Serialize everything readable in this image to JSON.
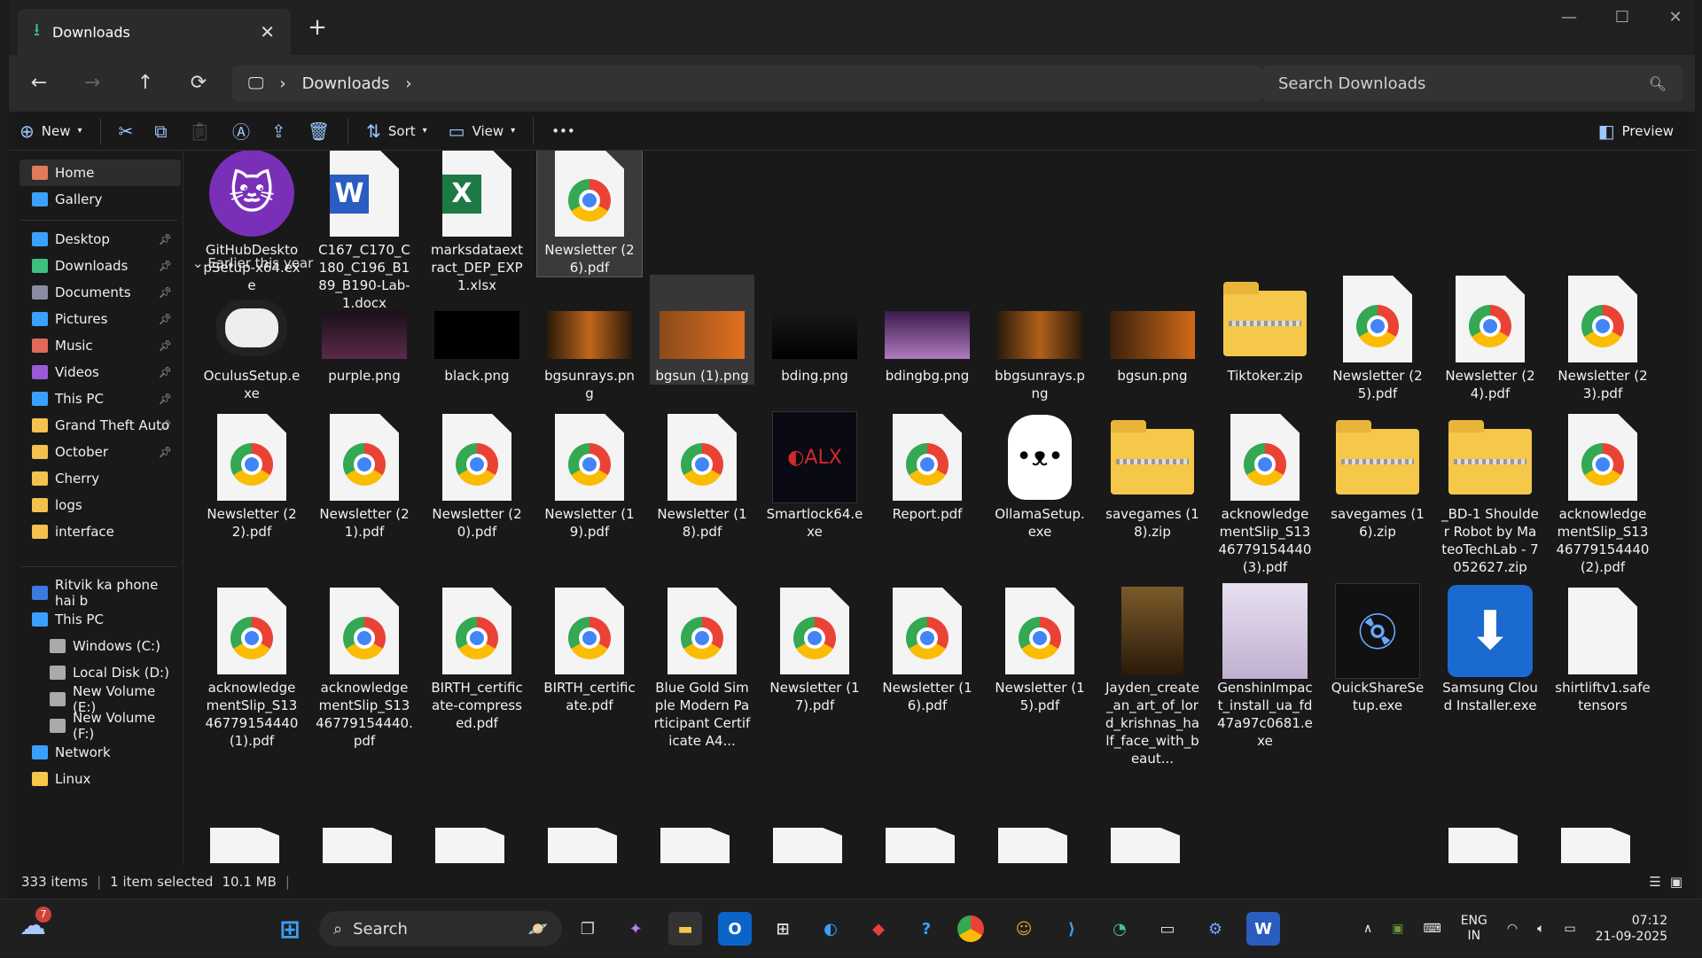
{
  "window": {
    "tab_title": "Downloads",
    "close": "✕",
    "new_tab": "+",
    "minimize": "—",
    "maximize": "☐",
    "close_window": "✕"
  },
  "nav": {
    "back": "←",
    "forward": "→",
    "up": "↑",
    "refresh": "⟳",
    "location": "Downloads",
    "crumb_sep": "›",
    "search_placeholder": "Search Downloads"
  },
  "commands": {
    "new": "New",
    "sort": "Sort",
    "view": "View",
    "more": "•••",
    "preview": "Preview"
  },
  "sidebar": {
    "top": [
      {
        "label": "Home"
      },
      {
        "label": "Gallery"
      }
    ],
    "pinned": [
      {
        "label": "Desktop",
        "color": "#3aa0ff"
      },
      {
        "label": "Downloads",
        "color": "#3fbf7f"
      },
      {
        "label": "Documents",
        "color": "#8a8aa0"
      },
      {
        "label": "Pictures",
        "color": "#3aa0ff"
      },
      {
        "label": "Music",
        "color": "#e06a5a"
      },
      {
        "label": "Videos",
        "color": "#9a5ad8"
      },
      {
        "label": "This PC",
        "color": "#3aa0ff"
      },
      {
        "label": "Grand Theft Auto",
        "color": "#f2c14e"
      },
      {
        "label": "October",
        "color": "#f2c14e"
      },
      {
        "label": "Cherry",
        "color": "#f2c14e"
      },
      {
        "label": "logs",
        "color": "#f2c14e"
      },
      {
        "label": "interface",
        "color": "#f2c14e"
      }
    ],
    "devices": [
      {
        "label": "Ritvik ka phone hai b"
      },
      {
        "label": "This PC"
      },
      {
        "label": "Windows (C:)"
      },
      {
        "label": "Local Disk (D:)"
      },
      {
        "label": "New Volume (E:)"
      },
      {
        "label": "New Volume (F:)"
      },
      {
        "label": "Network"
      },
      {
        "label": "Linux"
      }
    ]
  },
  "section_header": "Earlier this year",
  "files_recent": [
    {
      "name": "GitHubDesktopSetup-x64.exe",
      "kind": "github"
    },
    {
      "name": "C167_C170_C180_C196_B189_B190-Lab-1.docx",
      "kind": "word"
    },
    {
      "name": "marksdataextract_DEP_EXP1.xlsx",
      "kind": "excel"
    },
    {
      "name": "Newsletter (26).pdf",
      "kind": "pdf",
      "selected": true
    }
  ],
  "files_earlier": [
    {
      "name": "OculusSetup.exe",
      "kind": "oculus"
    },
    {
      "name": "purple.png",
      "kind": "img",
      "color": "linear-gradient(#1a0f1a,#5a2a4a)"
    },
    {
      "name": "black.png",
      "kind": "img",
      "color": "#000"
    },
    {
      "name": "bgsunrays.png",
      "kind": "img",
      "color": "linear-gradient(90deg,#2a1a0a,#c0661a,#2a1a0a)"
    },
    {
      "name": "bgsun (1).png",
      "kind": "img",
      "color": "linear-gradient(90deg,#8a4a1a,#e07020)",
      "hover": true
    },
    {
      "name": "bding.png",
      "kind": "img",
      "color": "linear-gradient(#191919,#000)"
    },
    {
      "name": "bdingbg.png",
      "kind": "img",
      "color": "linear-gradient(#3a1a4a,#b07ac0)"
    },
    {
      "name": "bbgsunrays.png",
      "kind": "img",
      "color": "linear-gradient(90deg,#2a1a0a,#b0601a,#2a1a0a)"
    },
    {
      "name": "bgsun.png",
      "kind": "img",
      "color": "linear-gradient(90deg,#3a200a,#d06a1a)"
    },
    {
      "name": "Tiktoker.zip",
      "kind": "zip"
    },
    {
      "name": "Newsletter (25).pdf",
      "kind": "pdf"
    },
    {
      "name": "Newsletter (24).pdf",
      "kind": "pdf"
    },
    {
      "name": "Newsletter (23).pdf",
      "kind": "pdf"
    },
    {
      "name": "Newsletter (22).pdf",
      "kind": "pdf"
    },
    {
      "name": "Newsletter (21).pdf",
      "kind": "pdf"
    },
    {
      "name": "Newsletter (20).pdf",
      "kind": "pdf"
    },
    {
      "name": "Newsletter (19).pdf",
      "kind": "pdf"
    },
    {
      "name": "Newsletter (18).pdf",
      "kind": "pdf"
    },
    {
      "name": "Smartlock64.exe",
      "kind": "smartlock"
    },
    {
      "name": "Report.pdf",
      "kind": "pdf"
    },
    {
      "name": "OllamaSetup.exe",
      "kind": "ollama"
    },
    {
      "name": "savegames (18).zip",
      "kind": "zip"
    },
    {
      "name": "acknowledgementSlip_S1346779154440 (3).pdf",
      "kind": "pdf"
    },
    {
      "name": "savegames (16).zip",
      "kind": "zip"
    },
    {
      "name": "_BD-1 Shoulder Robot by MateoTechLab - 7052627.zip",
      "kind": "zip"
    },
    {
      "name": "acknowledgementSlip_S1346779154440 (2).pdf",
      "kind": "pdf"
    },
    {
      "name": "acknowledgementSlip_S1346779154440 (1).pdf",
      "kind": "pdf"
    },
    {
      "name": "acknowledgementSlip_S1346779154440.pdf",
      "kind": "pdf"
    },
    {
      "name": "BIRTH_certificate-compressed.pdf",
      "kind": "pdf"
    },
    {
      "name": "BIRTH_certificate.pdf",
      "kind": "pdf"
    },
    {
      "name": "Blue Gold Simple Modern Participant Certificate A4...",
      "kind": "pdf"
    },
    {
      "name": "Newsletter (17).pdf",
      "kind": "pdf"
    },
    {
      "name": "Newsletter (16).pdf",
      "kind": "pdf"
    },
    {
      "name": "Newsletter (15).pdf",
      "kind": "pdf"
    },
    {
      "name": "Jayden_create_an_art_of_lord_krishnas_half_face_with_beaut...",
      "kind": "portrait"
    },
    {
      "name": "GenshinImpact_install_ua_fd47a97c0681.exe",
      "kind": "genshin"
    },
    {
      "name": "QuickShareSetup.exe",
      "kind": "quickshare"
    },
    {
      "name": "Samsung Cloud Installer.exe",
      "kind": "samsung"
    },
    {
      "name": "shirtliftv1.safetensors",
      "kind": "blank"
    }
  ],
  "status": {
    "count": "333 items",
    "selected": "1 item selected",
    "size": "10.1 MB"
  },
  "taskbar": {
    "search": "Search",
    "weather_badge": "7",
    "lang1": "ENG",
    "lang2": "IN",
    "time": "07:12",
    "date": "21-09-2025"
  }
}
